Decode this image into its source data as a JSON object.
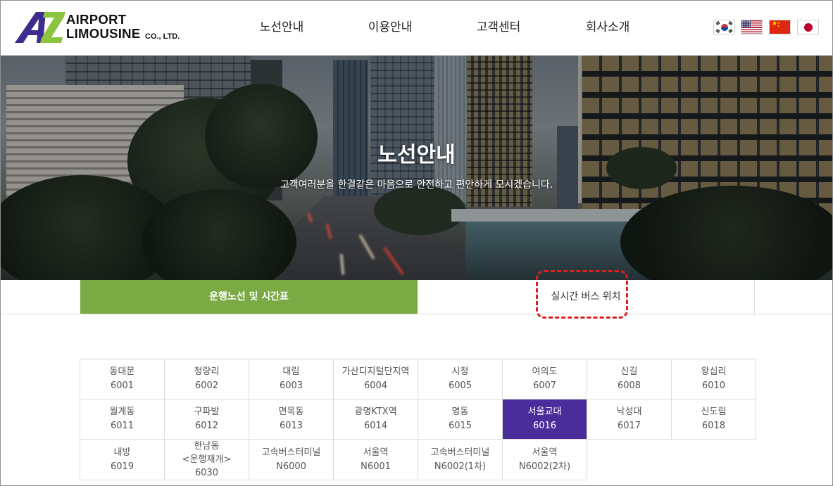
{
  "logo": {
    "mark": "AZ",
    "line1": "AIRPORT",
    "line2": "LIMOUSINE",
    "suffix": "CO., LTD."
  },
  "nav": [
    {
      "label": "노선안내"
    },
    {
      "label": "이용안내"
    },
    {
      "label": "고객센터"
    },
    {
      "label": "회사소개"
    }
  ],
  "languages": [
    {
      "icon": "flag-korea-icon"
    },
    {
      "icon": "flag-usa-icon"
    },
    {
      "icon": "flag-china-icon"
    },
    {
      "icon": "flag-japan-icon"
    }
  ],
  "hero": {
    "title": "노선안내",
    "subtitle": "고객여러분을 한결같은 마음으로 안전하고 편안하게 모시겠습니다."
  },
  "tabs": [
    {
      "label": "운행노선 및 시간표",
      "active": true
    },
    {
      "label": "실시간 버스 위치",
      "active": false
    }
  ],
  "routes": [
    {
      "name": "동대문",
      "code": "6001"
    },
    {
      "name": "청량리",
      "code": "6002"
    },
    {
      "name": "대림",
      "code": "6003"
    },
    {
      "name": "가산디지털단지역",
      "code": "6004"
    },
    {
      "name": "시청",
      "code": "6005"
    },
    {
      "name": "여의도",
      "code": "6007"
    },
    {
      "name": "신길",
      "code": "6008"
    },
    {
      "name": "왕십리",
      "code": "6010"
    },
    {
      "name": "월계동",
      "code": "6011"
    },
    {
      "name": "구파발",
      "code": "6012"
    },
    {
      "name": "면목동",
      "code": "6013"
    },
    {
      "name": "광명KTX역",
      "code": "6014"
    },
    {
      "name": "명동",
      "code": "6015"
    },
    {
      "name": "서울교대",
      "code": "6016",
      "selected": true
    },
    {
      "name": "낙성대",
      "code": "6017"
    },
    {
      "name": "신도림",
      "code": "6018"
    },
    {
      "name": "내방",
      "code": "6019"
    },
    {
      "name": "한남동",
      "note": "<운행재개>",
      "code": "6030"
    },
    {
      "name": "고속버스터미널",
      "code": "N6000"
    },
    {
      "name": "서울역",
      "code": "N6001"
    },
    {
      "name": "고속버스터미널",
      "code": "N6002(1차)"
    },
    {
      "name": "서울역",
      "code": "N6002(2차)"
    }
  ],
  "colors": {
    "brand_purple": "#3d2b8e",
    "brand_green": "#8bc43f",
    "tab_active": "#79aa44",
    "route_selected": "#4b2c9b",
    "annotation": "#e01e1e"
  }
}
